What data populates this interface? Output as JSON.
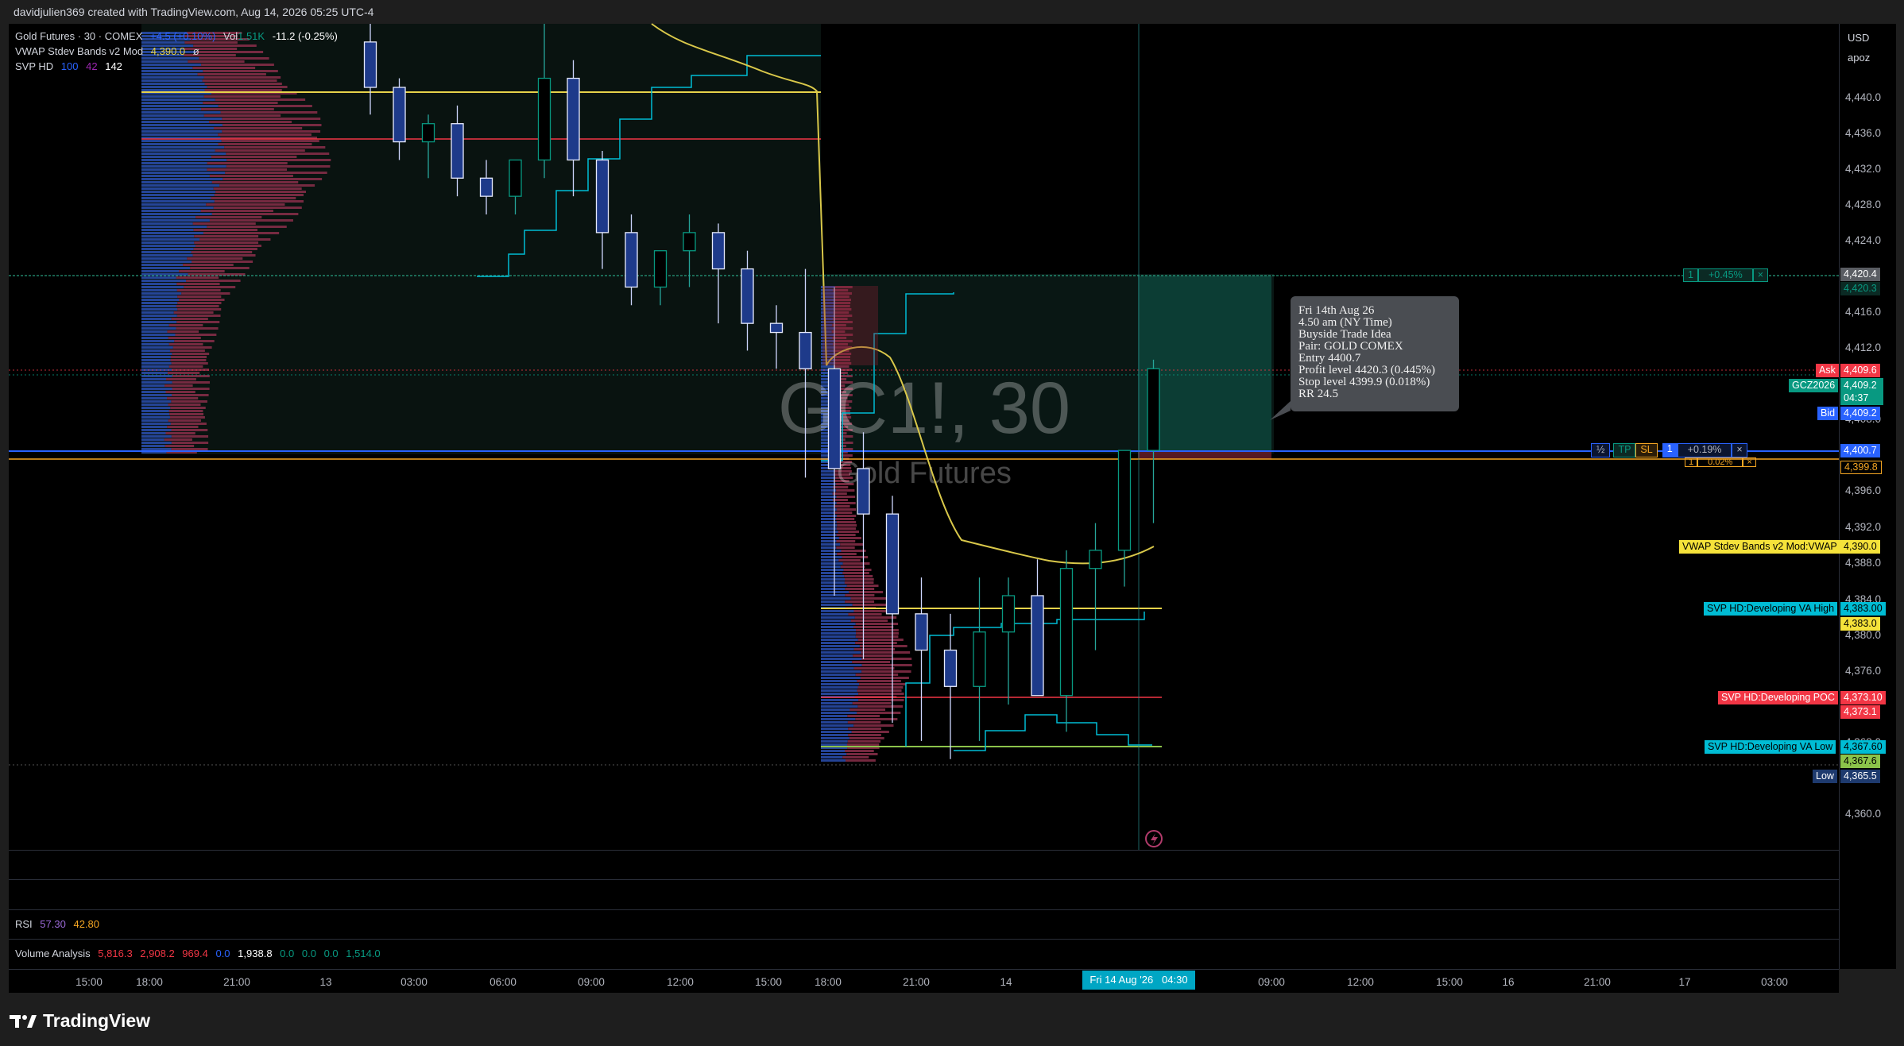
{
  "header": {
    "credit": "davidjulien369 created with TradingView.com, Aug 14, 2026 05:25 UTC-4"
  },
  "legend": {
    "symbol": "Gold Futures · 30 · COMEX",
    "change": "+4.5 (+0.10%)",
    "volume_label": "Vol",
    "volume_value": "1.51K",
    "volume_change": "-11.2 (-0.25%)",
    "vwap_name": "VWAP Stdev Bands v2 Mod",
    "vwap_value": "4,390.0",
    "vwap_extra": "ø",
    "svp_name": "SVP HD",
    "svp_vals": [
      "100",
      "42",
      "142"
    ]
  },
  "watermark": {
    "symbol": "GC1!, 30",
    "name": "Gold Futures"
  },
  "tooltip": {
    "lines": [
      "Fri 14th Aug 26",
      "4.50 am (NY Time)",
      "Buyside Trade Idea",
      "Pair: GOLD COMEX",
      "Entry 4400.7",
      "Profit level 4420.3 (0.445%)",
      "Stop level 4399.9 (0.018%)",
      "RR 24.5"
    ]
  },
  "position_tool": {
    "tp_qty": "1",
    "tp_pct": "+0.45%",
    "entry_qty": "1",
    "entry_pct": "+0.19%",
    "sl_qty": "1",
    "sl_pct": "0.02%",
    "half": "½",
    "tp": "TP",
    "sl": "SL",
    "close": "×"
  },
  "price_scale": {
    "currency": "USD",
    "settings": "apoz",
    "ticks": [
      "4,440.0",
      "4,436.0",
      "4,432.0",
      "4,428.0",
      "4,424.0",
      "4,416.0",
      "4,412.0",
      "4,408.0",
      "4,396.0",
      "4,392.0",
      "4,388.0",
      "4,384.0",
      "4,380.0",
      "4,376.0",
      "4,368.0",
      "4,360.0"
    ],
    "tags": {
      "tp": "4,420.4",
      "tp2": "4,420.3",
      "ask_label": "Ask",
      "ask": "4,409.6",
      "symbol_label": "GCZ2026",
      "last": "4,409.2",
      "countdown": "04:37",
      "bid_label": "Bid",
      "bid": "4,409.2",
      "entry": "4,400.7",
      "sl": "4,399.8",
      "vwap_label": "VWAP Stdev Bands v2 Mod:VWAP",
      "vwap": "4,390.0",
      "vah_label": "SVP HD:Developing VA High",
      "vah": "4,383.00",
      "vah2": "4,383.0",
      "poc_label": "SVP HD:Developing POC",
      "poc": "4,373.10",
      "poc2": "4,373.1",
      "val_label": "SVP HD:Developing VA Low",
      "val": "4,367.60",
      "val2": "4,367.6",
      "low_label": "Low",
      "low": "4,365.5"
    }
  },
  "rsi": {
    "name": "RSI",
    "v1": "57.30",
    "v2": "42.80"
  },
  "volume_analysis": {
    "name": "Volume Analysis",
    "vals": [
      "5,816.3",
      "2,908.2",
      "969.4",
      "0.0",
      "1,938.8",
      "0.0",
      "0.0",
      "0.0",
      "1,514.0"
    ]
  },
  "time_axis": {
    "labels": [
      "15:00",
      "18:00",
      "21:00",
      "13",
      "03:00",
      "06:00",
      "09:00",
      "12:00",
      "15:00",
      "18:00",
      "21:00",
      "14",
      "09:00",
      "12:00",
      "15:00",
      "16",
      "21:00",
      "17",
      "03:00"
    ],
    "cursor": "Fri 14 Aug '26   04:30"
  },
  "brand": {
    "name": "TradingView"
  },
  "colors": {
    "bull": "#089981",
    "bear": "#f23645",
    "accent": "#2962ff",
    "vwap": "#d9c84a",
    "va": "#00bcd4",
    "poc": "#f23645"
  },
  "chart_data": {
    "type": "candlestick",
    "title": "GC1!, 30",
    "subtitle": "Gold Futures",
    "ylim": [
      4356,
      4447
    ],
    "x": [
      "13 15:00",
      "13 15:30",
      "13 16:00",
      "13 16:30",
      "13 17:00",
      "13 17:30",
      "13 18:00",
      "13 18:30",
      "13 19:00",
      "13 19:30",
      "13 20:00",
      "13 20:30",
      "13 21:00",
      "13 21:30",
      "13 22:00",
      "13 22:30",
      "13 23:00",
      "13 23:30",
      "14 00:00",
      "14 00:30",
      "14 01:00",
      "14 01:30",
      "14 02:00",
      "14 02:30",
      "14 03:00",
      "14 03:30",
      "14 04:00",
      "14 04:30"
    ],
    "open": [
      4445,
      4440,
      4434,
      4436,
      4430,
      4428,
      4432,
      4441,
      4432,
      4424,
      4418,
      4422,
      4424,
      4420,
      4414,
      4413,
      4409,
      4398,
      4393,
      4382,
      4378,
      4374,
      4380,
      4384,
      4373,
      4387,
      4389,
      4400
    ],
    "high": [
      4447,
      4441,
      4437,
      4438,
      4432,
      4431,
      4447,
      4443,
      4433,
      4426,
      4421,
      4426,
      4425,
      4422,
      4416,
      4420,
      4418,
      4402,
      4395,
      4386,
      4382,
      4386,
      4386,
      4388,
      4389,
      4392,
      4396,
      4410
    ],
    "low": [
      4437,
      4432,
      4430,
      4428,
      4426,
      4426,
      4430,
      4428,
      4420,
      4416,
      4416,
      4418,
      4414,
      4411,
      4409,
      4397,
      4384,
      4377,
      4370,
      4368,
      4366,
      4368,
      4372,
      4376,
      4369,
      4378,
      4385,
      4392
    ],
    "close": [
      4440,
      4434,
      4436,
      4430,
      4428,
      4432,
      4441,
      4432,
      4424,
      4418,
      4422,
      4424,
      4420,
      4414,
      4413,
      4409,
      4398,
      4393,
      4382,
      4378,
      4374,
      4380,
      4384,
      4373,
      4387,
      4389,
      4400,
      4409
    ]
  }
}
